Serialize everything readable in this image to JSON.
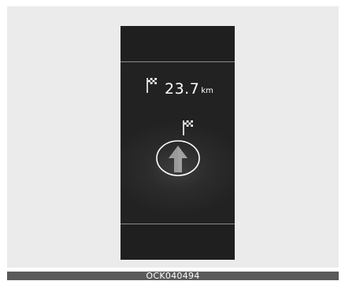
{
  "display": {
    "distance_value": "23.7",
    "distance_unit": "km"
  },
  "icons": {
    "distance_flag": "checkered-flag-icon",
    "destination_flag": "checkered-flag-icon",
    "direction": "straight-arrow-icon"
  },
  "caption": {
    "code": "OCK040494"
  },
  "colors": {
    "screen": "#222222",
    "text": "#ffffff",
    "arrow": "#9a9a9a",
    "caption_bar": "#5a5a5a"
  }
}
